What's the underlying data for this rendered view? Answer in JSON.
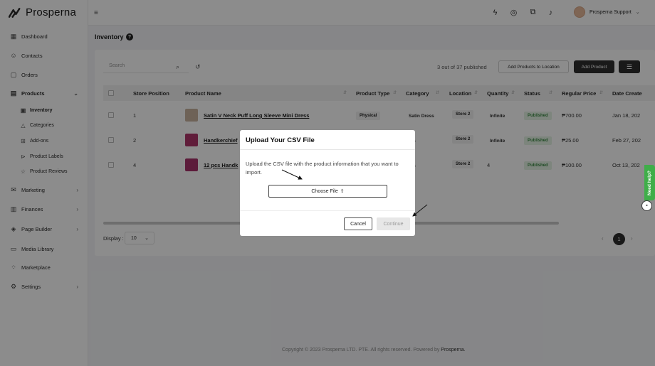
{
  "app": {
    "brand": "Prosperna"
  },
  "sidebar": {
    "items": [
      {
        "label": "Dashboard",
        "icon": "dashboard-icon"
      },
      {
        "label": "Contacts",
        "icon": "contacts-icon"
      },
      {
        "label": "Orders",
        "icon": "orders-icon"
      },
      {
        "label": "Products",
        "icon": "products-icon"
      },
      {
        "label": "Marketing",
        "icon": "marketing-icon"
      },
      {
        "label": "Finances",
        "icon": "finances-icon"
      },
      {
        "label": "Page Builder",
        "icon": "page-builder-icon"
      },
      {
        "label": "Media Library",
        "icon": "media-library-icon"
      },
      {
        "label": "Marketplace",
        "icon": "marketplace-icon"
      },
      {
        "label": "Settings",
        "icon": "settings-icon"
      }
    ],
    "products_sub": [
      {
        "label": "Inventory"
      },
      {
        "label": "Categories"
      },
      {
        "label": "Add-ons"
      },
      {
        "label": "Product Labels"
      },
      {
        "label": "Product Reviews"
      }
    ]
  },
  "topbar": {
    "user_name": "Prosperna Support"
  },
  "page": {
    "title": "Inventory",
    "search_placeholder": "Search",
    "published_text": "3 out of 37 published",
    "add_to_location": "Add Products to Location",
    "add_product": "Add Product"
  },
  "table": {
    "headers": [
      "Store Position",
      "Product Name",
      "Product Type",
      "Category",
      "Location",
      "Quantity",
      "Status",
      "Regular Price",
      "Date Create"
    ],
    "rows": [
      {
        "position": "1",
        "name": "Satin V Neck Puff Long Sleeve Mini Dress",
        "type": "Physical",
        "category": "Satin Dress",
        "location": "Store 2",
        "quantity": "Infinite",
        "status": "Published",
        "price": "₱700.00",
        "date": "Jan 18, 202"
      },
      {
        "position": "2",
        "name": "Handkerchief",
        "type": "",
        "category": "ers",
        "location": "Store 2",
        "quantity": "Infinite",
        "status": "Published",
        "price": "₱25.00",
        "date": "Feb 27, 202"
      },
      {
        "position": "4",
        "name": "12 pcs Handk",
        "type": "",
        "category": "ers",
        "location": "Store 2",
        "quantity": "4",
        "status": "Published",
        "price": "₱100.00",
        "date": "Oct 13, 202"
      }
    ]
  },
  "pagination": {
    "display_label": "Display :",
    "display_value": "10",
    "current_page": "1"
  },
  "footer": {
    "text": "Copyright © 2023 Prosperna LTD. PTE. All rights reserved. Powered by ",
    "link": "Prosperna."
  },
  "help": {
    "label": "Need help?"
  },
  "modal": {
    "title": "Upload Your CSV File",
    "description": "Upload the CSV file with the product information that you want to import.",
    "choose_file": "Choose File",
    "cancel": "Cancel",
    "continue": "Continue"
  },
  "colors": {
    "accent_dark": "#2f2f2f",
    "published_green": "#3d8a45",
    "help_green": "#3fae49"
  }
}
